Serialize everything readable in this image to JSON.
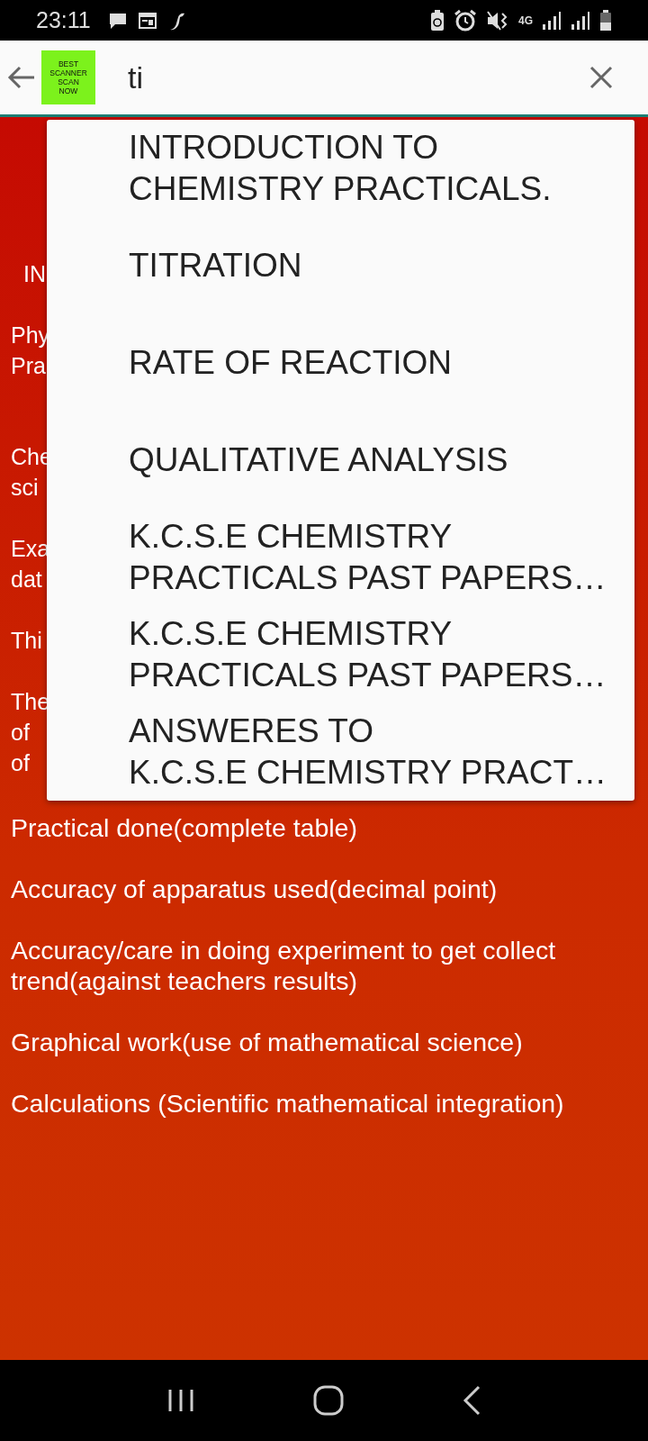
{
  "status_bar": {
    "time": "23:11",
    "network": "4G"
  },
  "app_bar": {
    "logo_lines": [
      "BEST",
      "SCANNER",
      "SCAN",
      "NOW"
    ],
    "search": {
      "value": "ti"
    }
  },
  "content": {
    "paragraphs": [
      {
        "lines": [
          "IN"
        ]
      },
      {
        "lines": [
          "Phy",
          "Pra"
        ]
      },
      {
        "lines": [
          "Che",
          "sci"
        ]
      },
      {
        "lines": [
          "Exa",
          "dat"
        ]
      },
      {
        "lines": [
          "Thi"
        ]
      },
      {
        "lines": [
          "The",
          "of",
          "of"
        ]
      },
      {
        "lines": [
          "Practical done(complete table)"
        ]
      },
      {
        "lines": [
          "Accuracy of apparatus used(decimal point)"
        ]
      },
      {
        "lines": [
          "Accuracy/care in doing experiment to get collect",
          "trend(against teachers results)"
        ]
      },
      {
        "lines": [
          "Graphical work(use of mathematical science)"
        ]
      },
      {
        "lines": [
          "Calculations (Scientific mathematical integration)"
        ]
      }
    ]
  },
  "suggestions": [
    {
      "lines": [
        "INTRODUCTION TO",
        "CHEMISTRY PRACTICALS."
      ]
    },
    {
      "lines": [
        "TITRATION"
      ]
    },
    {
      "lines": [
        "RATE OF REACTION"
      ]
    },
    {
      "lines": [
        "QUALITATIVE ANALYSIS"
      ]
    },
    {
      "lines": [
        "K.C.S.E CHEMISTRY",
        "PRACTICALS PAST PAPERS…"
      ]
    },
    {
      "lines": [
        "K.C.S.E CHEMISTRY",
        "PRACTICALS PAST PAPERS…"
      ]
    },
    {
      "lines": [
        "ANSWERES TO",
        "K.C.S.E CHEMISTRY PRACT…"
      ]
    }
  ]
}
